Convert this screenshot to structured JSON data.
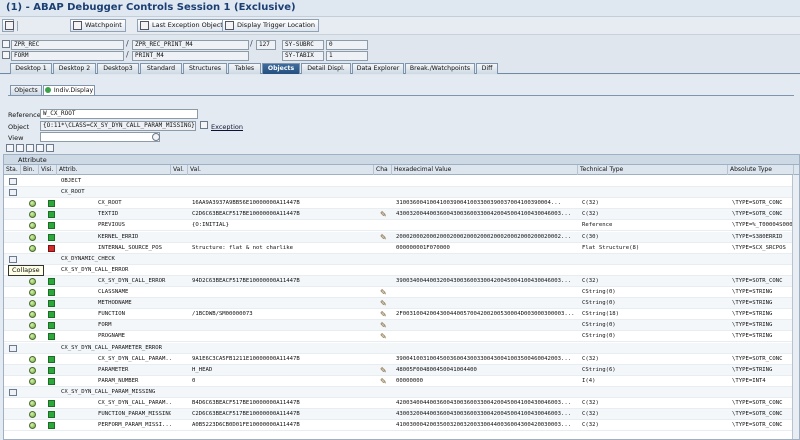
{
  "window": {
    "title": "(1) - ABAP Debugger Controls Session 1 (Exclusive)"
  },
  "toolbar": {
    "watchpoint": "Watchpoint",
    "last_exception": "Last Exception Object",
    "display_trigger": "Display Trigger Location"
  },
  "fields": {
    "program": "ZPR_REC",
    "include": "ZPR_REC_PRINT_M4",
    "line": "127",
    "subrc_label": "SY-SUBRC",
    "subrc": "0",
    "event_type": "FORM",
    "event": "PRINT_M4",
    "tabix_label": "SY-TABIX",
    "tabix": "1"
  },
  "tabs": [
    "Desktop 1",
    "Desktop 2",
    "Desktop3",
    "Standard",
    "Structures",
    "Tables",
    "Objects",
    "Detail Displ.",
    "Data Explorer",
    "Break./Watchpoints",
    "Diff"
  ],
  "subtabs": [
    "Objects",
    "Indiv.Display"
  ],
  "form": {
    "reference_label": "Reference",
    "reference_value": "W_CX_ROOT",
    "object_label": "Object",
    "object_value": "{O:11*\\CLASS=CX_SY_DYN_CALL_PARAM_MISSING}",
    "exception_link": "Exception",
    "view_label": "View"
  },
  "grid": {
    "title": "Attribute",
    "headers": [
      "Sta.",
      "Bin.",
      "Visi.",
      "Attrib.",
      "Val.",
      "Val.",
      "Cha",
      "Hexadecimal Value",
      "Technical Type",
      "Absolute Type"
    ],
    "tooltip": "Collapse",
    "rows": [
      {
        "kind": "group",
        "attrib": "OBJECT",
        "val": "",
        "hex": "",
        "tech": "",
        "abs": "",
        "indent": 0
      },
      {
        "kind": "group",
        "attrib": "CX_ROOT",
        "val": "",
        "hex": "",
        "tech": "",
        "abs": "",
        "indent": 0
      },
      {
        "kind": "attr",
        "attrib": "CX_ROOT",
        "val": "16AA9A3937A9BB56E10000000A11447B",
        "pencil": false,
        "hex": "3100360041004100390041003300390037004100390004...",
        "tech": "C(32)",
        "abs": "\\TYPE=SOTR_CONC"
      },
      {
        "kind": "attr",
        "attrib": "TEXTID",
        "val": "C2D6C63BEACF517BE10000000A11447B",
        "pencil": true,
        "hex": "4300320044003600430036003300420045004100430046003...",
        "tech": "C(32)",
        "abs": "\\TYPE=SOTR_CONC"
      },
      {
        "kind": "attr",
        "attrib": "PREVIOUS",
        "val": "{O:INITIAL}",
        "pencil": false,
        "hex": "",
        "tech": "Reference",
        "abs": "\\TYPE=%_T00004S000006"
      },
      {
        "kind": "attr",
        "attrib": "KERNEL_ERRID",
        "val": "",
        "pencil": true,
        "hex": "2000200020002000200020002000200020002000200020002...",
        "tech": "C(30)",
        "abs": "\\TYPE=S380ERRID"
      },
      {
        "kind": "attr-red",
        "attrib": "INTERNAL_SOURCE_POS",
        "val": "Structure: flat & not charlike",
        "pencil": false,
        "hex": "000000001F070000",
        "tech": "Flat Structure(8)",
        "abs": "\\TYPE=SCX_SRCPOS"
      },
      {
        "kind": "group",
        "attrib": "CX_DYNAMIC_CHECK",
        "val": "",
        "hex": "",
        "tech": "",
        "abs": "",
        "indent": 0
      },
      {
        "kind": "group",
        "attrib": "CX_SY_DYN_CALL_ERROR",
        "val": "",
        "hex": "",
        "tech": "",
        "abs": "",
        "indent": 0
      },
      {
        "kind": "attr",
        "attrib": "CX_SY_DYN_CALL_ERROR",
        "val": "94D2C63BEACF517BE10000000A11447B",
        "pencil": false,
        "hex": "3900340044003200430036003300420045004100430046003...",
        "tech": "C(32)",
        "abs": "\\TYPE=SOTR_CONC"
      },
      {
        "kind": "attr",
        "attrib": "CLASSNAME",
        "val": "",
        "pencil": true,
        "hex": "",
        "tech": "CString(0)",
        "abs": "\\TYPE=STRING"
      },
      {
        "kind": "attr",
        "attrib": "METHODNAME",
        "val": "",
        "pencil": true,
        "hex": "",
        "tech": "CString(0)",
        "abs": "\\TYPE=STRING"
      },
      {
        "kind": "attr",
        "attrib": "FUNCTION",
        "val": "/1BCDWB/SM00000073",
        "pencil": true,
        "hex": "2F00310042004300440057004200200530004D003000300003...",
        "tech": "CString(18)",
        "abs": "\\TYPE=STRING"
      },
      {
        "kind": "attr",
        "attrib": "FORM",
        "val": "",
        "pencil": true,
        "hex": "",
        "tech": "CString(0)",
        "abs": "\\TYPE=STRING"
      },
      {
        "kind": "attr",
        "attrib": "PROGNAME",
        "val": "",
        "pencil": true,
        "hex": "",
        "tech": "CString(0)",
        "abs": "\\TYPE=STRING"
      },
      {
        "kind": "group",
        "attrib": "CX_SY_DYN_CALL_PARAMETER_ERROR",
        "val": "",
        "hex": "",
        "tech": "",
        "abs": "",
        "indent": 0
      },
      {
        "kind": "attr",
        "attrib": "CX_SY_DYN_CALL_PARAM...",
        "val": "9A1E6C3CA5FB1211E10000000A11447B",
        "pencil": false,
        "hex": "3900410031004500360043003300430041003500460042003...",
        "tech": "C(32)",
        "abs": "\\TYPE=SOTR_CONC"
      },
      {
        "kind": "attr",
        "attrib": "PARAMETER",
        "val": "H_HEAD",
        "pencil": true,
        "hex": "48005F004800450041004400",
        "tech": "CString(6)",
        "abs": "\\TYPE=STRING"
      },
      {
        "kind": "attr",
        "attrib": "PARAM_NUMBER",
        "val": "0",
        "pencil": true,
        "hex": "00000000",
        "tech": "I(4)",
        "abs": "\\TYPE=INT4"
      },
      {
        "kind": "group",
        "attrib": "CX_SY_DYN_CALL_PARAM_MISSING",
        "val": "",
        "hex": "",
        "tech": "",
        "abs": "",
        "indent": 0
      },
      {
        "kind": "attr",
        "attrib": "CX_SY_DYN_CALL_PARAM...",
        "val": "B4D6C63BEACF517BE10000000A11447B",
        "pencil": false,
        "hex": "4200340044003600430036003300420045004100430046003...",
        "tech": "C(32)",
        "abs": "\\TYPE=SOTR_CONC"
      },
      {
        "kind": "attr",
        "attrib": "FUNCTION_PARAM_MISSING",
        "val": "C2D6C63BEACF517BE10000000A11447B",
        "pencil": false,
        "hex": "4300320044003600430036003300420045004100430046003...",
        "tech": "C(32)",
        "abs": "\\TYPE=SOTR_CONC"
      },
      {
        "kind": "attr",
        "attrib": "PERFORM_PARAM_MISSI...",
        "val": "A0B5223D6CB0D01FE10000000A11447B",
        "pencil": false,
        "hex": "4100300042003500320032003300440036004300420030003...",
        "tech": "C(32)",
        "abs": "\\TYPE=SOTR_CONC"
      }
    ]
  }
}
